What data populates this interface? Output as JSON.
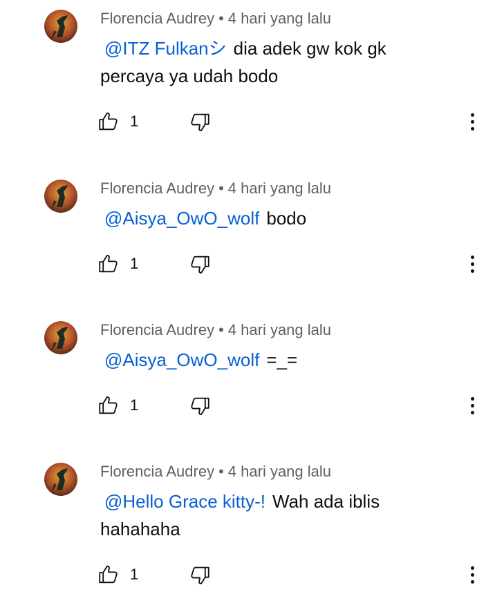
{
  "comments": [
    {
      "author": "Florencia Audrey",
      "separator": "•",
      "time": "4 hari yang lalu",
      "mention": "@ITZ Fulkanシ",
      "text": "dia adek gw kok gk percaya ya udah bodo",
      "likes": "1"
    },
    {
      "author": "Florencia Audrey",
      "separator": "•",
      "time": "4 hari yang lalu",
      "mention": "@Aisya_OwO_wolf",
      "text": "bodo",
      "likes": "1"
    },
    {
      "author": "Florencia Audrey",
      "separator": "•",
      "time": "4 hari yang lalu",
      "mention": "@Aisya_OwO_wolf",
      "text": "=_=",
      "likes": "1"
    },
    {
      "author": "Florencia Audrey",
      "separator": "•",
      "time": "4 hari yang lalu",
      "mention": "@Hello Grace kitty-!",
      "text": "Wah ada iblis hahahaha",
      "likes": "1"
    }
  ],
  "icons": {
    "like": "thumbs-up-outline-icon",
    "dislike": "thumbs-down-outline-icon",
    "more": "more-vertical-icon",
    "avatar": "profile-avatar-icon"
  },
  "colors": {
    "mention": "#065fd4",
    "meta": "#606060",
    "text": "#0f0f0f"
  }
}
